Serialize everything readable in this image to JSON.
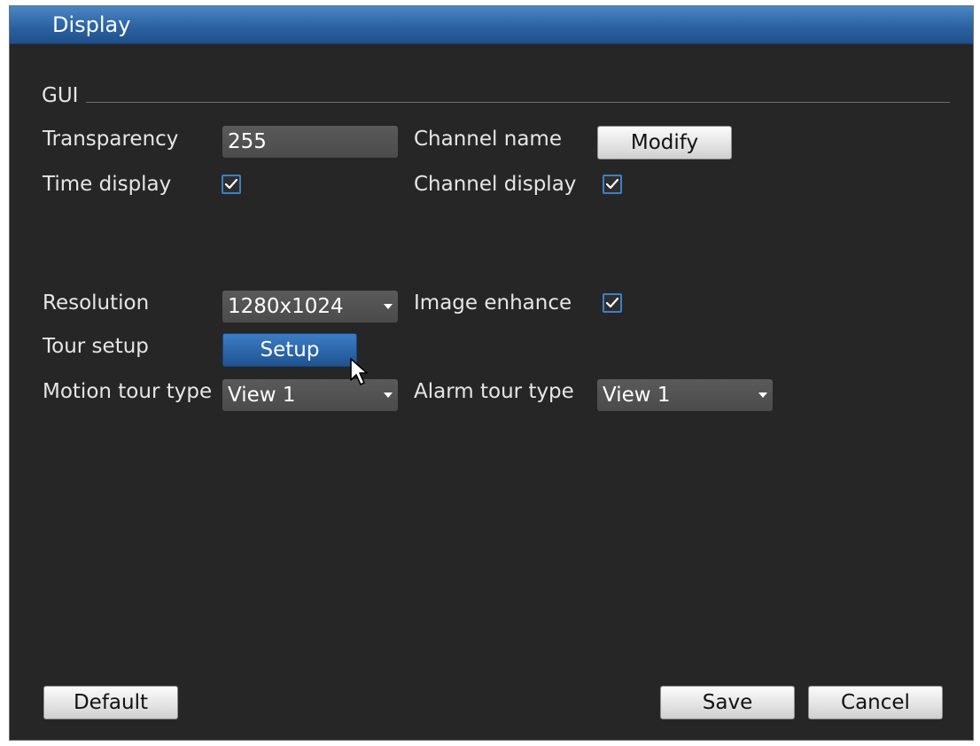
{
  "window": {
    "title": "Display"
  },
  "gui_section": {
    "label": "GUI"
  },
  "transparency": {
    "label": "Transparency",
    "value": "255"
  },
  "channel_name": {
    "label": "Channel name",
    "button_label": "Modify"
  },
  "time_display": {
    "label": "Time display",
    "checked": true
  },
  "channel_display": {
    "label": "Channel display",
    "checked": true
  },
  "resolution": {
    "label": "Resolution",
    "value": "1280x1024"
  },
  "image_enhance": {
    "label": "Image enhance",
    "checked": true
  },
  "tour_setup": {
    "label": "Tour setup",
    "button_label": "Setup"
  },
  "motion_tour_type": {
    "label": "Motion tour type",
    "value": "View 1"
  },
  "alarm_tour_type": {
    "label": "Alarm tour type",
    "value": "View 1"
  },
  "footer": {
    "default_label": "Default",
    "save_label": "Save",
    "cancel_label": "Cancel"
  },
  "colors": {
    "title_bar": "#2c63a3",
    "background": "#262626",
    "checkbox_border": "#3d7fc6",
    "accent_button": "#2a64a6"
  },
  "icons": {
    "checkbox": "checkmark-icon",
    "dropdown": "caret-down-icon",
    "pointer": "mouse-pointer-icon"
  }
}
